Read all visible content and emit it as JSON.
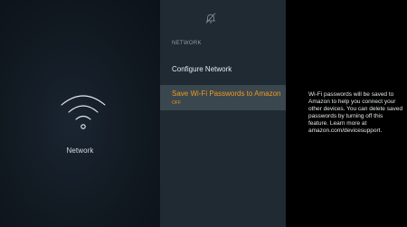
{
  "left_panel": {
    "icon": "wifi-icon",
    "label": "Network"
  },
  "menu": {
    "top_icon": "mute-icon",
    "section_heading": "NETWORK",
    "items": [
      {
        "label": "Configure Network"
      },
      {
        "label": "Save Wi-Fi Passwords to Amazon",
        "status": "OFF"
      }
    ],
    "focus_color": "#f29a1f"
  },
  "description": {
    "text": "Wi-Fi passwords will be saved to Amazon to help you connect your other devices. You can delete saved passwords by turning off this feature. Learn more at amazon.com/devicesupport."
  }
}
